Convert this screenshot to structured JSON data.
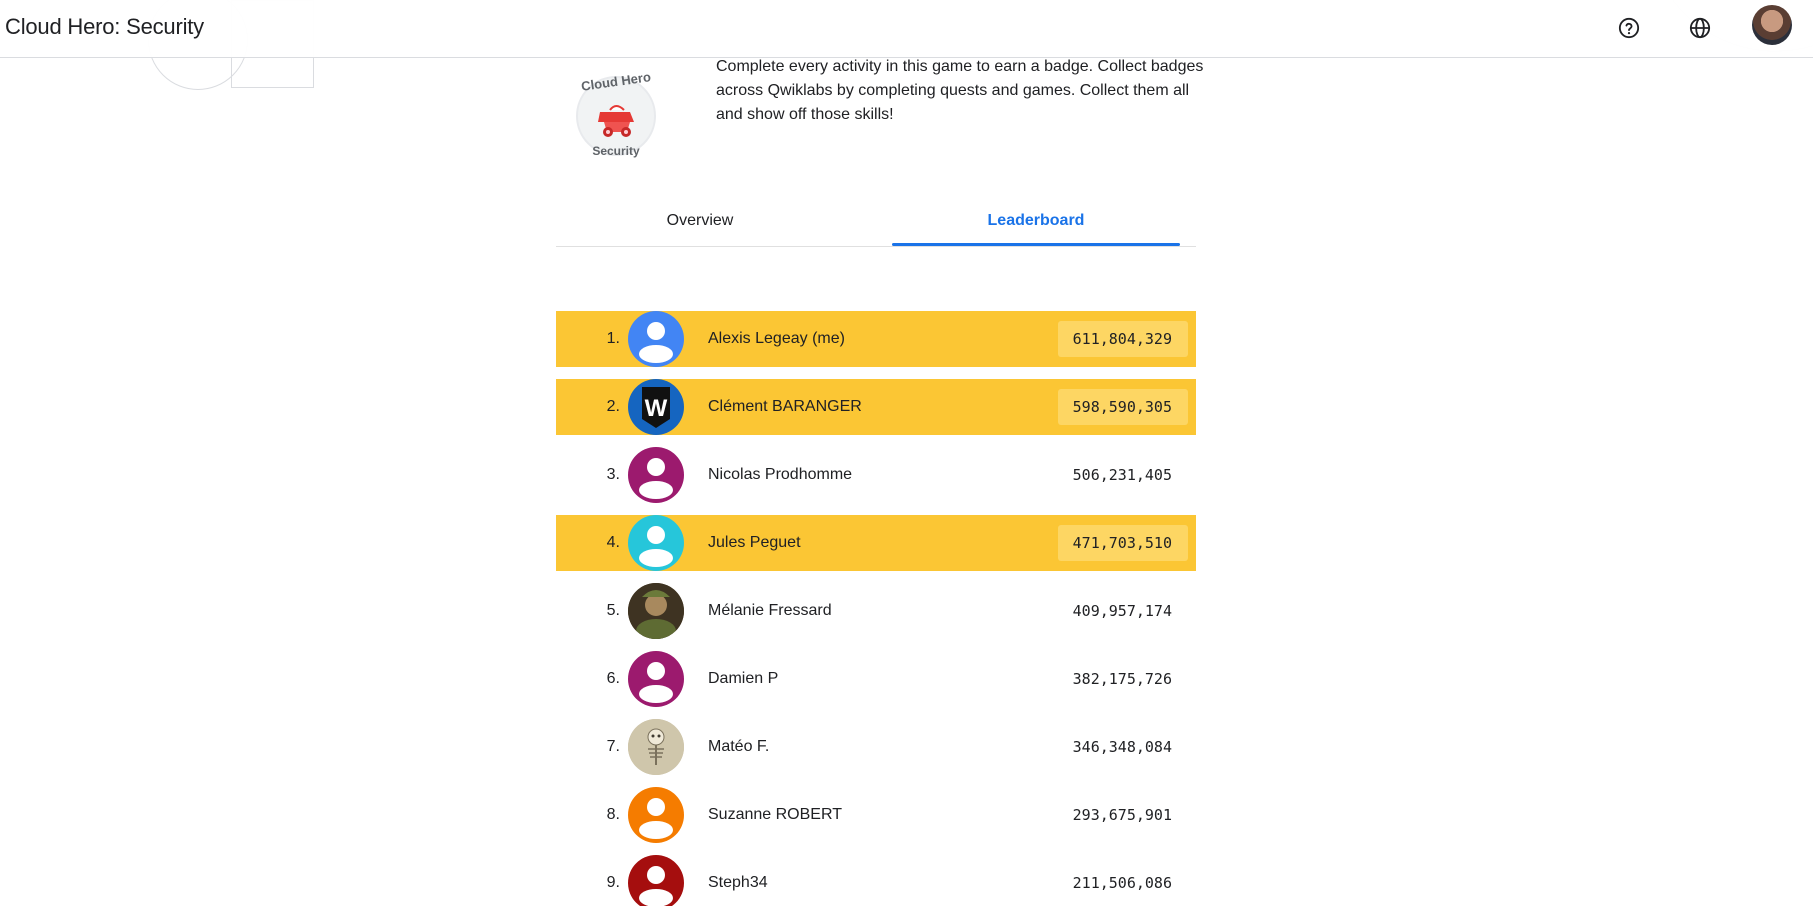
{
  "header": {
    "title": "Cloud Hero: Security",
    "help_icon": "help-circle-icon",
    "language_icon": "globe-icon"
  },
  "badge": {
    "top_text": "Cloud Hero",
    "bottom_text": "Security"
  },
  "description": "Complete every activity in this game to earn a badge. Collect badges across Qwiklabs by completing quests and games. Collect them all and show off those skills!",
  "tabs": [
    {
      "label": "Overview",
      "active": false
    },
    {
      "label": "Leaderboard",
      "active": true
    }
  ],
  "colors": {
    "accent": "#1a73e8",
    "highlight_row": "#fbc634",
    "highlight_score": "#fdd663"
  },
  "leaderboard": [
    {
      "rank": "1.",
      "name": "Alexis Legeay (me)",
      "score": "611,804,329",
      "highlight": true,
      "avatar": "default",
      "avatar_color": "#4285f4"
    },
    {
      "rank": "2.",
      "name": "Clément BARANGER",
      "score": "598,590,305",
      "highlight": true,
      "avatar": "w-logo",
      "avatar_color": "#1565c0"
    },
    {
      "rank": "3.",
      "name": "Nicolas Prodhomme",
      "score": "506,231,405",
      "highlight": false,
      "avatar": "default",
      "avatar_color": "#9c1a6e"
    },
    {
      "rank": "4.",
      "name": "Jules Peguet",
      "score": "471,703,510",
      "highlight": true,
      "avatar": "default",
      "avatar_color": "#26c6da"
    },
    {
      "rank": "5.",
      "name": "Mélanie Fressard",
      "score": "409,957,174",
      "highlight": false,
      "avatar": "photo",
      "avatar_color": "#5d4a2c"
    },
    {
      "rank": "6.",
      "name": "Damien P",
      "score": "382,175,726",
      "highlight": false,
      "avatar": "default",
      "avatar_color": "#9c1a6e"
    },
    {
      "rank": "7.",
      "name": "Matéo F.",
      "score": "346,348,084",
      "highlight": false,
      "avatar": "skeleton",
      "avatar_color": "#c9bfa3"
    },
    {
      "rank": "8.",
      "name": "Suzanne ROBERT",
      "score": "293,675,901",
      "highlight": false,
      "avatar": "default",
      "avatar_color": "#f57c00"
    },
    {
      "rank": "9.",
      "name": "Steph34",
      "score": "211,506,086",
      "highlight": false,
      "avatar": "default",
      "avatar_color": "#a50e0e"
    }
  ]
}
